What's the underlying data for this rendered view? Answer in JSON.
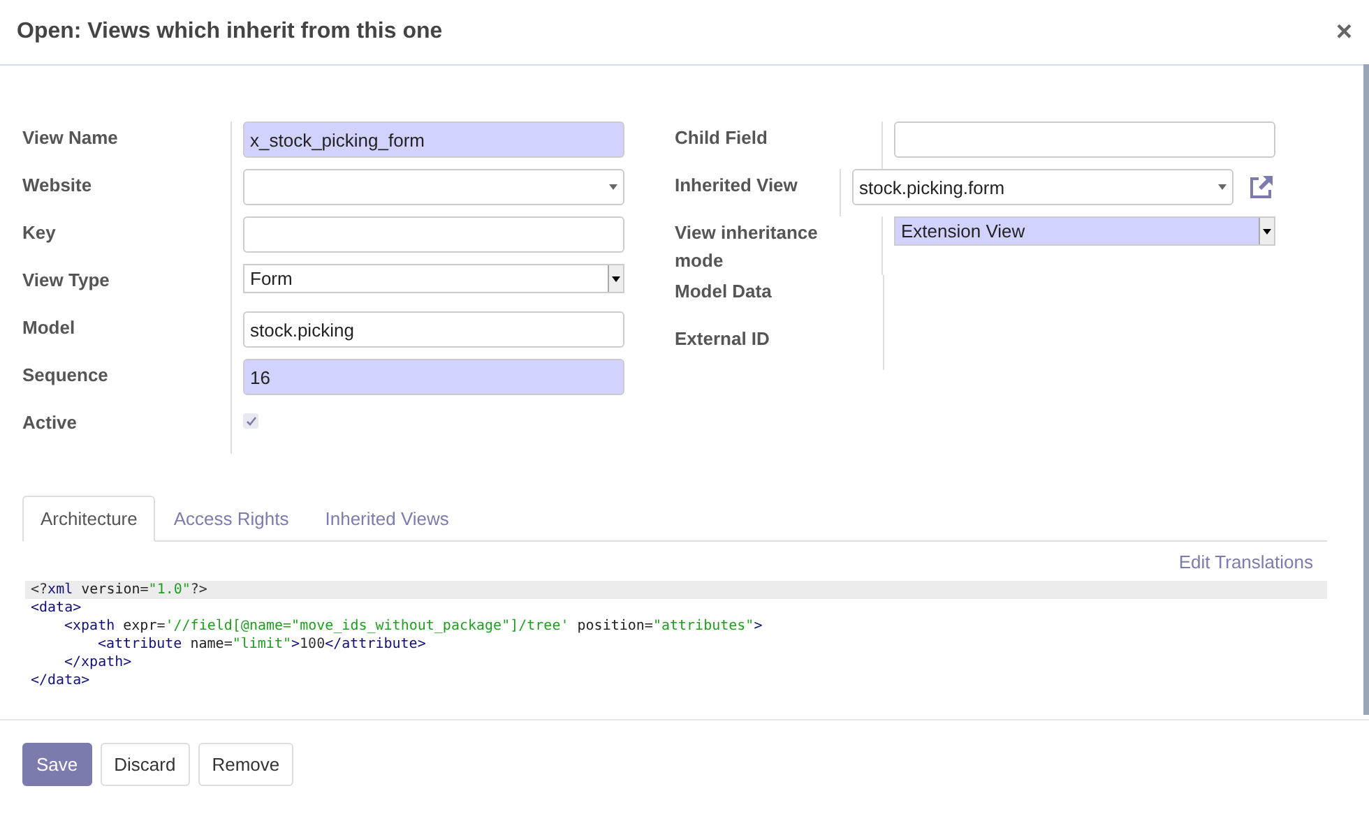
{
  "dialog": {
    "title": "Open: Views which inherit from this one",
    "close": "×"
  },
  "left_fields": [
    {
      "label": "View Name",
      "kind": "text",
      "value": "x_stock_picking_form",
      "required": true
    },
    {
      "label": "Website",
      "kind": "dropdown",
      "required": false
    },
    {
      "label": "Key",
      "kind": "text",
      "required": false
    },
    {
      "label": "View Type",
      "kind": "select",
      "value": "Form",
      "required": false
    },
    {
      "label": "Model",
      "kind": "text",
      "value": "stock.picking",
      "required": false
    },
    {
      "label": "Sequence",
      "kind": "text",
      "value": "16",
      "required": true
    },
    {
      "label": "Active",
      "kind": "checkbox",
      "checked": true
    }
  ],
  "right_fields": [
    {
      "label": "Child Field",
      "kind": "text",
      "required": false
    },
    {
      "label": "Inherited View",
      "kind": "dropdown",
      "value": "stock.picking.form",
      "required": false,
      "external_link": true
    },
    {
      "label": "View inheritance mode",
      "kind": "select",
      "value": "Extension View",
      "required": true
    },
    {
      "label": "Model Data",
      "kind": "none"
    },
    {
      "label": "External ID",
      "kind": "none"
    }
  ],
  "tabs": [
    {
      "label": "Architecture",
      "selected": true
    },
    {
      "label": "Access Rights",
      "selected": false
    },
    {
      "label": "Inherited Views",
      "selected": false
    }
  ],
  "edit_translations": "Edit Translations",
  "code": [
    {
      "tokens": [
        {
          "kind": "punct",
          "text": "<?"
        },
        {
          "kind": "tag",
          "text": "xml"
        },
        {
          "kind": "attr",
          "text": " version="
        },
        {
          "kind": "value",
          "text": "\"1.0\""
        },
        {
          "kind": "punct",
          "text": "?>"
        }
      ],
      "current": true
    },
    {
      "tokens": [
        {
          "kind": "tag",
          "text": "<data>"
        }
      ],
      "current": false,
      "children": [
        {
          "tokens": [
            {
              "kind": "tag",
              "text": "<xpath"
            },
            {
              "kind": "attr",
              "text": " expr="
            },
            {
              "kind": "value",
              "text": "'//field[@name=\"move_ids_without_package\"]/tree'"
            },
            {
              "kind": "attr",
              "text": " position="
            },
            {
              "kind": "value",
              "text": "\"attributes\""
            },
            {
              "kind": "tag",
              "text": ">"
            }
          ],
          "current": false,
          "children": [
            {
              "tokens": [
                {
                  "kind": "tag",
                  "text": "<attribute"
                },
                {
                  "kind": "attr",
                  "text": " name="
                },
                {
                  "kind": "value",
                  "text": "\"limit\""
                },
                {
                  "kind": "tag",
                  "text": ">"
                },
                {
                  "kind": "punct",
                  "text": "100"
                },
                {
                  "kind": "tag",
                  "text": "</attribute>"
                }
              ],
              "current": false
            }
          ]
        },
        {
          "tokens": [
            {
              "kind": "tag",
              "text": "</xpath>"
            }
          ],
          "current": false
        }
      ]
    },
    {
      "tokens": [
        {
          "kind": "tag",
          "text": "</data>"
        }
      ],
      "current": false
    }
  ],
  "buttons": [
    {
      "label": "Save",
      "kind": "primary"
    },
    {
      "label": "Discard",
      "kind": "secondary"
    },
    {
      "label": "Remove",
      "kind": "secondary"
    }
  ]
}
